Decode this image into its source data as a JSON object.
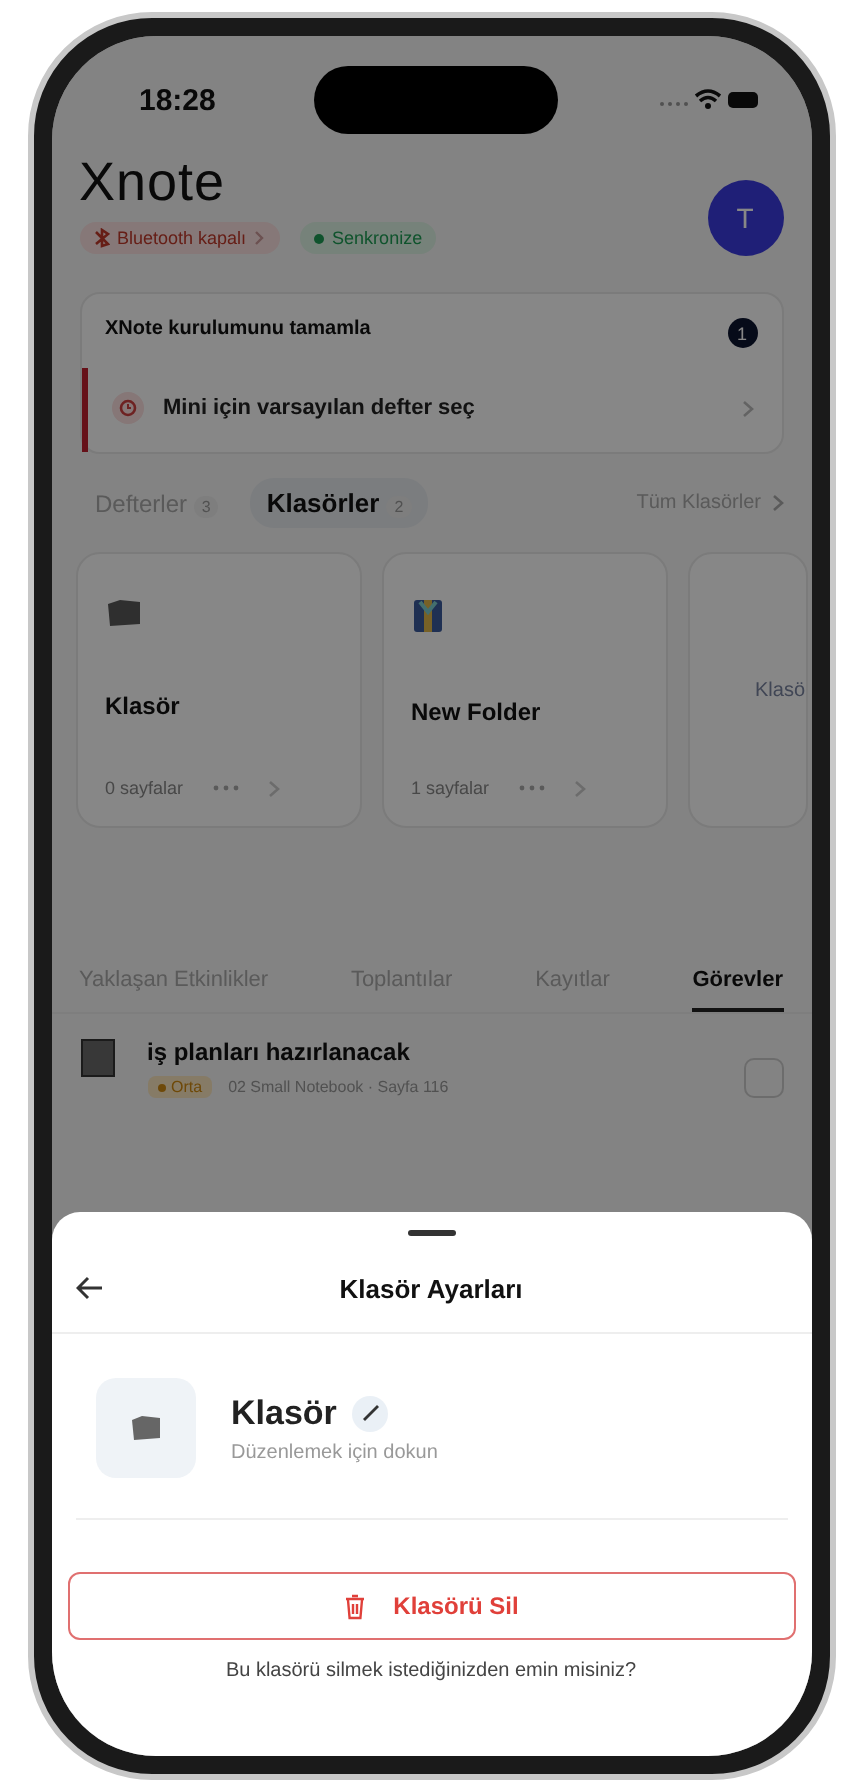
{
  "status_bar": {
    "time": "18:28"
  },
  "header": {
    "logo": "Xnote",
    "avatar": "T",
    "chips": [
      {
        "kind": "warning",
        "label": "Bluetooth kapalı"
      },
      {
        "kind": "success",
        "label": "Senkronize"
      }
    ]
  },
  "setup_card": {
    "title": "XNote kurulumunu tamamla",
    "badge": "1",
    "task": "Mini için varsayılan defter seç"
  },
  "section_tabs": [
    {
      "label": "Defterler",
      "count": "3",
      "selected": false
    },
    {
      "label": "Klasörler",
      "count": "2",
      "selected": true
    }
  ],
  "see_all": "Tüm Klasörler",
  "folders": [
    {
      "kind": "plain",
      "name": "Klasör",
      "pages": "0 sayfalar"
    },
    {
      "kind": "binder",
      "name": "New Folder",
      "pages": "1 sayfalar"
    },
    {
      "kind": "partial",
      "name": "Klasö"
    }
  ],
  "feed_tabs": [
    {
      "label": "Yaklaşan Etkinlikler",
      "selected": false
    },
    {
      "label": "Toplantılar",
      "selected": false
    },
    {
      "label": "Kayıtlar",
      "selected": false
    },
    {
      "label": "Görevler",
      "selected": true
    }
  ],
  "tasks": [
    {
      "title": "iş planları hazırlanacak",
      "priority": "Orta",
      "source": "02 Small Notebook · Sayfa 116",
      "checked": false
    }
  ],
  "sheet": {
    "title": "Klasör Ayarları",
    "folder_name": "Klasör",
    "hint": "Düzenlemek için dokun",
    "delete_label": "Klasörü Sil",
    "confirm": "Bu klasörü silmek istediğinizden emin misiniz?"
  }
}
